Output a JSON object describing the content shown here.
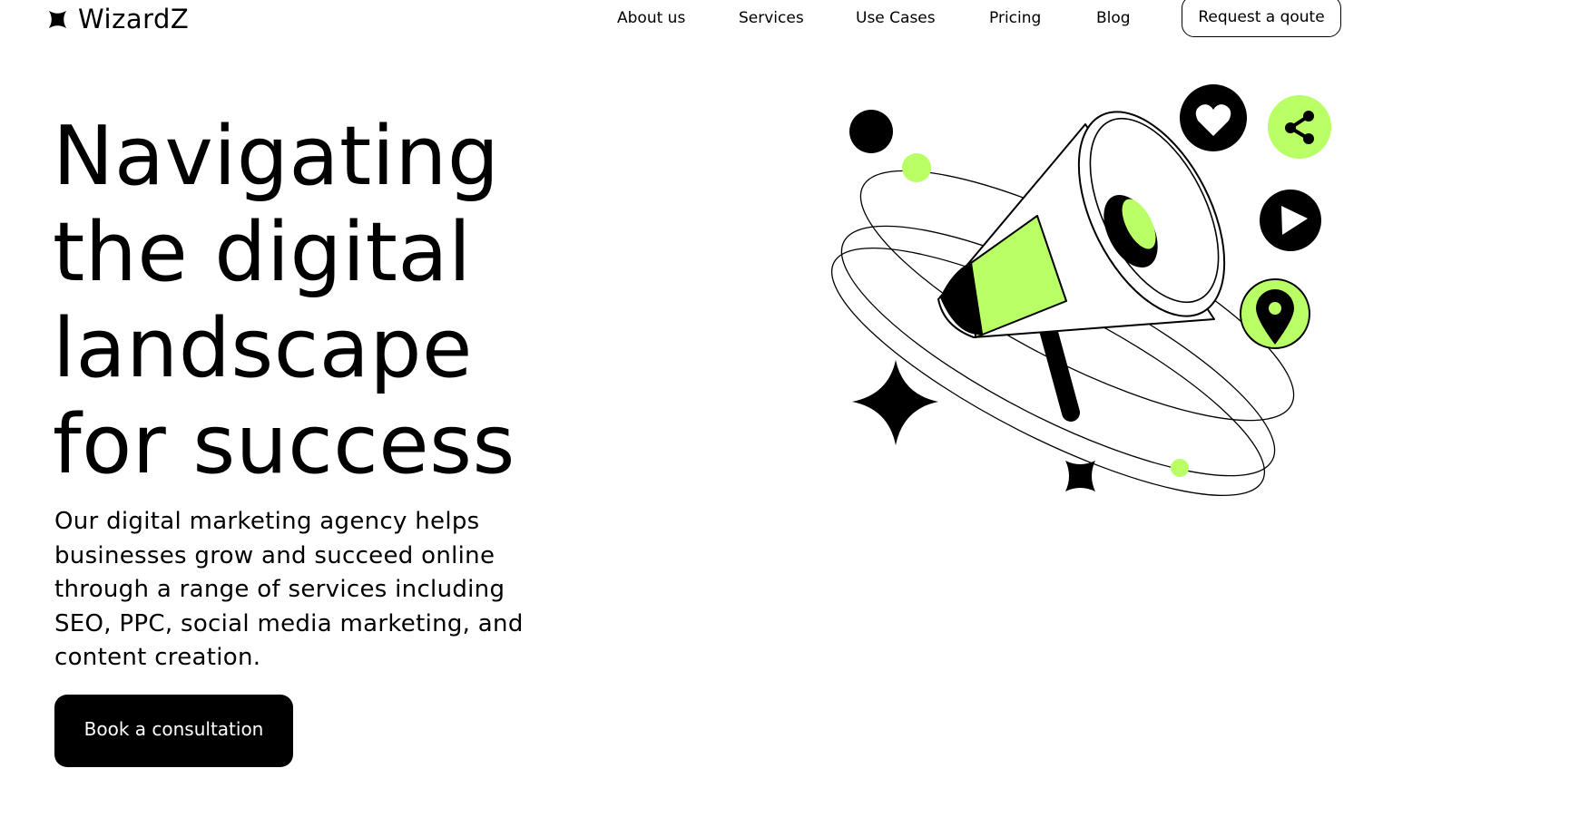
{
  "brand": {
    "name": "WizardZ"
  },
  "nav": {
    "links": [
      "About us",
      "Services",
      "Use Cases",
      "Pricing",
      "Blog"
    ],
    "quote_button": "Request a qoute"
  },
  "hero": {
    "title_lines": [
      "Navigating",
      "the digital",
      "landscape",
      "for success"
    ],
    "description": "Our digital marketing agency helps businesses grow and succeed online through a range of services including SEO, PPC, social media marketing, and content creation.",
    "cta": "Book a consultation"
  },
  "colors": {
    "accent": "#b9ff66",
    "dark": "#000000",
    "background": "#ffffff"
  },
  "illustration": {
    "icons": [
      "megaphone-icon",
      "heart-icon",
      "share-icon",
      "play-icon",
      "location-pin-icon",
      "sparkle-icon"
    ]
  }
}
